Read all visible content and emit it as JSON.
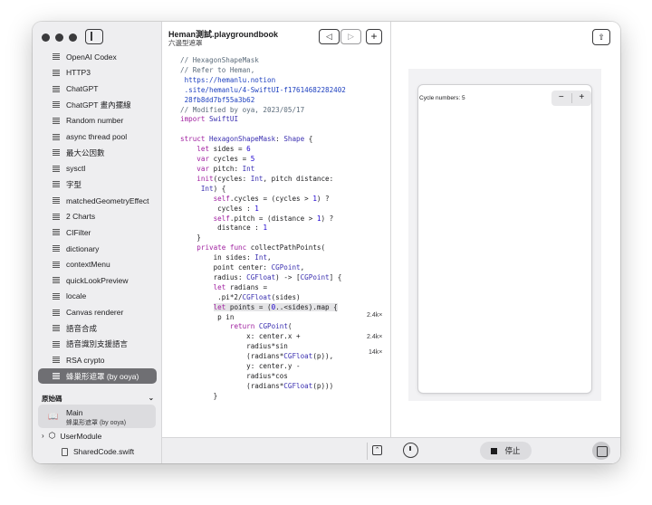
{
  "sidebar": {
    "items": [
      {
        "label": "OpenAI Codex"
      },
      {
        "label": "HTTP3"
      },
      {
        "label": "ChatGPT"
      },
      {
        "label": "ChatGPT 畫內擺線"
      },
      {
        "label": "Random number"
      },
      {
        "label": "async thread pool"
      },
      {
        "label": "最大公因數"
      },
      {
        "label": "sysctl"
      },
      {
        "label": "字型"
      },
      {
        "label": "matchedGeometryEffect"
      },
      {
        "label": "2 Charts"
      },
      {
        "label": "CIFilter"
      },
      {
        "label": "dictionary"
      },
      {
        "label": "contextMenu"
      },
      {
        "label": "quickLookPreview"
      },
      {
        "label": "locale"
      },
      {
        "label": "Canvas renderer"
      },
      {
        "label": "語音合成"
      },
      {
        "label": "語音識別支援語言"
      },
      {
        "label": "RSA crypto"
      },
      {
        "label": "蜂巢形遮罩 (by ooya)"
      }
    ],
    "selected_index": 20,
    "source_section": "原始碼",
    "source_main_title": "Main",
    "source_main_subtitle": "蜂巢形遮罩 (by ooya)",
    "module_label": "UserModule",
    "shared_file": "SharedCode.swift"
  },
  "editor": {
    "title": "Heman測試.playgroundbook",
    "subtitle": "六邊型遮罩",
    "hints": [
      "2.4k×",
      "2.4k×",
      "14k×"
    ],
    "code": [
      {
        "t": "// HexagonShapeMask",
        "k": "cm"
      },
      {
        "t": "// Refer to Heman,",
        "k": "cm"
      },
      {
        "t": " https://hemanlu.notion",
        "k": "url"
      },
      {
        "t": " .site/hemanlu/4-SwiftUI-f17614682282402",
        "k": "url"
      },
      {
        "t": " 28fb8dd7bf55a3b62",
        "k": "url"
      },
      {
        "t": "// Modified by oya, 2023/05/17",
        "k": "cm"
      },
      {
        "t": "import SwiftUI",
        "k": "import"
      },
      {
        "t": "",
        "k": ""
      },
      {
        "t": "struct HexagonShapeMask: Shape {",
        "k": "struct"
      },
      {
        "t": "    let sides = 6",
        "k": "let"
      },
      {
        "t": "    var cycles = 5",
        "k": "var"
      },
      {
        "t": "    var pitch: Int",
        "k": "var"
      },
      {
        "t": "    init(cycles: Int, pitch distance:",
        "k": "init"
      },
      {
        "t": "     Int) {",
        "k": "plain"
      },
      {
        "t": "        self.cycles = (cycles > 1) ?",
        "k": "self"
      },
      {
        "t": "         cycles : 1",
        "k": "plain"
      },
      {
        "t": "        self.pitch = (distance > 1) ?",
        "k": "self"
      },
      {
        "t": "         distance : 1",
        "k": "plain"
      },
      {
        "t": "    }",
        "k": "plain"
      },
      {
        "t": "    private func collectPathPoints(",
        "k": "func"
      },
      {
        "t": "        in sides: Int,",
        "k": "plain"
      },
      {
        "t": "        point center: CGPoint,",
        "k": "plain"
      },
      {
        "t": "        radius: CGFloat) -> [CGPoint] {",
        "k": "plain"
      },
      {
        "t": "        let radians =",
        "k": "let"
      },
      {
        "t": "         .pi*2/CGFloat(sides)",
        "k": "plain"
      },
      {
        "t": "        let points = (0..<sides).map {",
        "k": "hl"
      },
      {
        "t": "         p in",
        "k": "plain"
      },
      {
        "t": "            return CGPoint(",
        "k": "return"
      },
      {
        "t": "                x: center.x +",
        "k": "plain"
      },
      {
        "t": "                radius*sin",
        "k": "plain"
      },
      {
        "t": "                (radians*CGFloat(p)),",
        "k": "plain"
      },
      {
        "t": "                y: center.y -",
        "k": "plain"
      },
      {
        "t": "                radius*cos",
        "k": "plain"
      },
      {
        "t": "                (radians*CGFloat(p)))",
        "k": "plain"
      },
      {
        "t": "        }",
        "k": "plain"
      }
    ]
  },
  "preview": {
    "cycle_label": "Cycle numbers: 5",
    "stepper_minus": "−",
    "stepper_plus": "+",
    "stop_label": "停止"
  }
}
